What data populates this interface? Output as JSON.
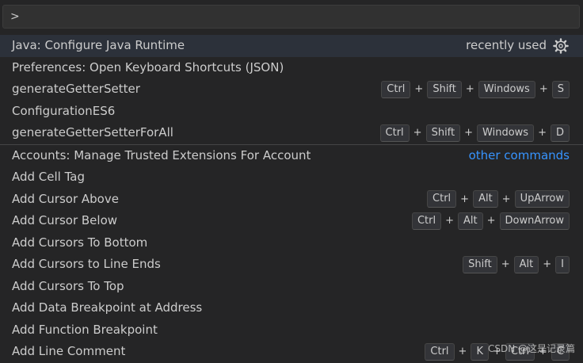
{
  "input": {
    "value": ">"
  },
  "selected": {
    "label": "Java: Configure Java Runtime",
    "hint": "recently used",
    "icon": "gear-icon"
  },
  "recent": [
    {
      "label": "Preferences: Open Keyboard Shortcuts (JSON)"
    },
    {
      "label": "generateGetterSetter"
    },
    {
      "label": "ConfigurationES6"
    },
    {
      "label": "generateGetterSetterForAll"
    }
  ],
  "other_hint": "other commands",
  "others": [
    {
      "label": "Accounts: Manage Trusted Extensions For Account"
    },
    {
      "label": "Add Cell Tag"
    },
    {
      "label": "Add Cursor Above"
    },
    {
      "label": "Add Cursor Below"
    },
    {
      "label": "Add Cursors To Bottom"
    },
    {
      "label": "Add Cursors to Line Ends"
    },
    {
      "label": "Add Cursors To Top"
    },
    {
      "label": "Add Data Breakpoint at Address"
    },
    {
      "label": "Add Function Breakpoint"
    },
    {
      "label": "Add Line Comment"
    }
  ],
  "shortcuts": {
    "generateGetterSetter": [
      "Ctrl",
      "Shift",
      "Windows",
      "S"
    ],
    "generateGetterSetterForAll": [
      "Ctrl",
      "Shift",
      "Windows",
      "D"
    ],
    "add_cursor_above": [
      "Ctrl",
      "Alt",
      "UpArrow"
    ],
    "add_cursor_below": [
      "Ctrl",
      "Alt",
      "DownArrow"
    ],
    "add_cursors_line_ends": [
      "Shift",
      "Alt",
      "I"
    ],
    "add_line_comment": [
      "Ctrl",
      "K",
      "Ctrl",
      "C"
    ]
  },
  "watermark": "CSDN @这是记录篇",
  "colors": {
    "background": "#252526",
    "selected_row": "#2c313a",
    "link": "#3794ff"
  }
}
